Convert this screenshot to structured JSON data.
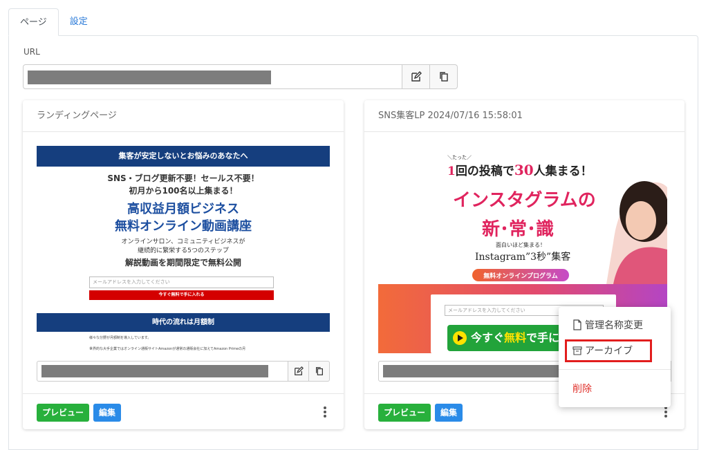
{
  "tabs": [
    {
      "label": "ページ",
      "active": true
    },
    {
      "label": "設定",
      "active": false
    }
  ],
  "url_section": {
    "label": "URL",
    "value": ""
  },
  "cards": [
    {
      "title": "ランディングページ",
      "preview_label": "プレビュー",
      "edit_label": "編集",
      "thumbnail": {
        "banner": "集客が安定しないとお悩みのあなたへ",
        "line1": "SNS・ブログ更新不要！セールス不要！",
        "line2": "初月から100名以上集まる！",
        "headline1": "高収益月額ビジネス",
        "headline2": "無料オンライン動画講座",
        "sub1": "オンラインサロン、コミュニティビジネスが",
        "sub2": "継続的に繁栄する5つのステップ",
        "sub3": "解説動画を期間限定で無料公開",
        "email_placeholder": "メールアドレスを入力してください",
        "cta": "今すぐ無料で手に入れる",
        "banner2": "時代の流れは月額制",
        "small1": "様々な分野が月額制を導入しています。",
        "small2": "世界的な大手企業ではオンライン通販サイトAmazonが通常の通販会社に加えてAmazon Primeの月"
      }
    },
    {
      "title": "SNS集客LP 2024/07/16 15:58:01",
      "preview_label": "プレビュー",
      "edit_label": "編集",
      "thumbnail": {
        "tag": "＼たった／",
        "line1_a": "1",
        "line1_b": "回の投稿で",
        "line1_c": "30",
        "line1_d": "人集まる！",
        "big1": "インスタグラムの",
        "big2": "新･常･識",
        "sub1": "面白いほど集まる！",
        "sub2": "Instagram”3秒”集客",
        "pill": "無料オンラインプログラム",
        "email_placeholder": "メールアドレスを入力してください",
        "cta_a": "今すぐ",
        "cta_b": "無料",
        "cta_c": "で手に入"
      }
    }
  ],
  "menu": {
    "rename": "管理名称変更",
    "archive": "アーカイブ",
    "delete": "削除"
  },
  "colors": {
    "accent": "#2a8be8",
    "preview": "#28b03c",
    "danger": "#e21d1d",
    "navy": "#153e7e"
  }
}
